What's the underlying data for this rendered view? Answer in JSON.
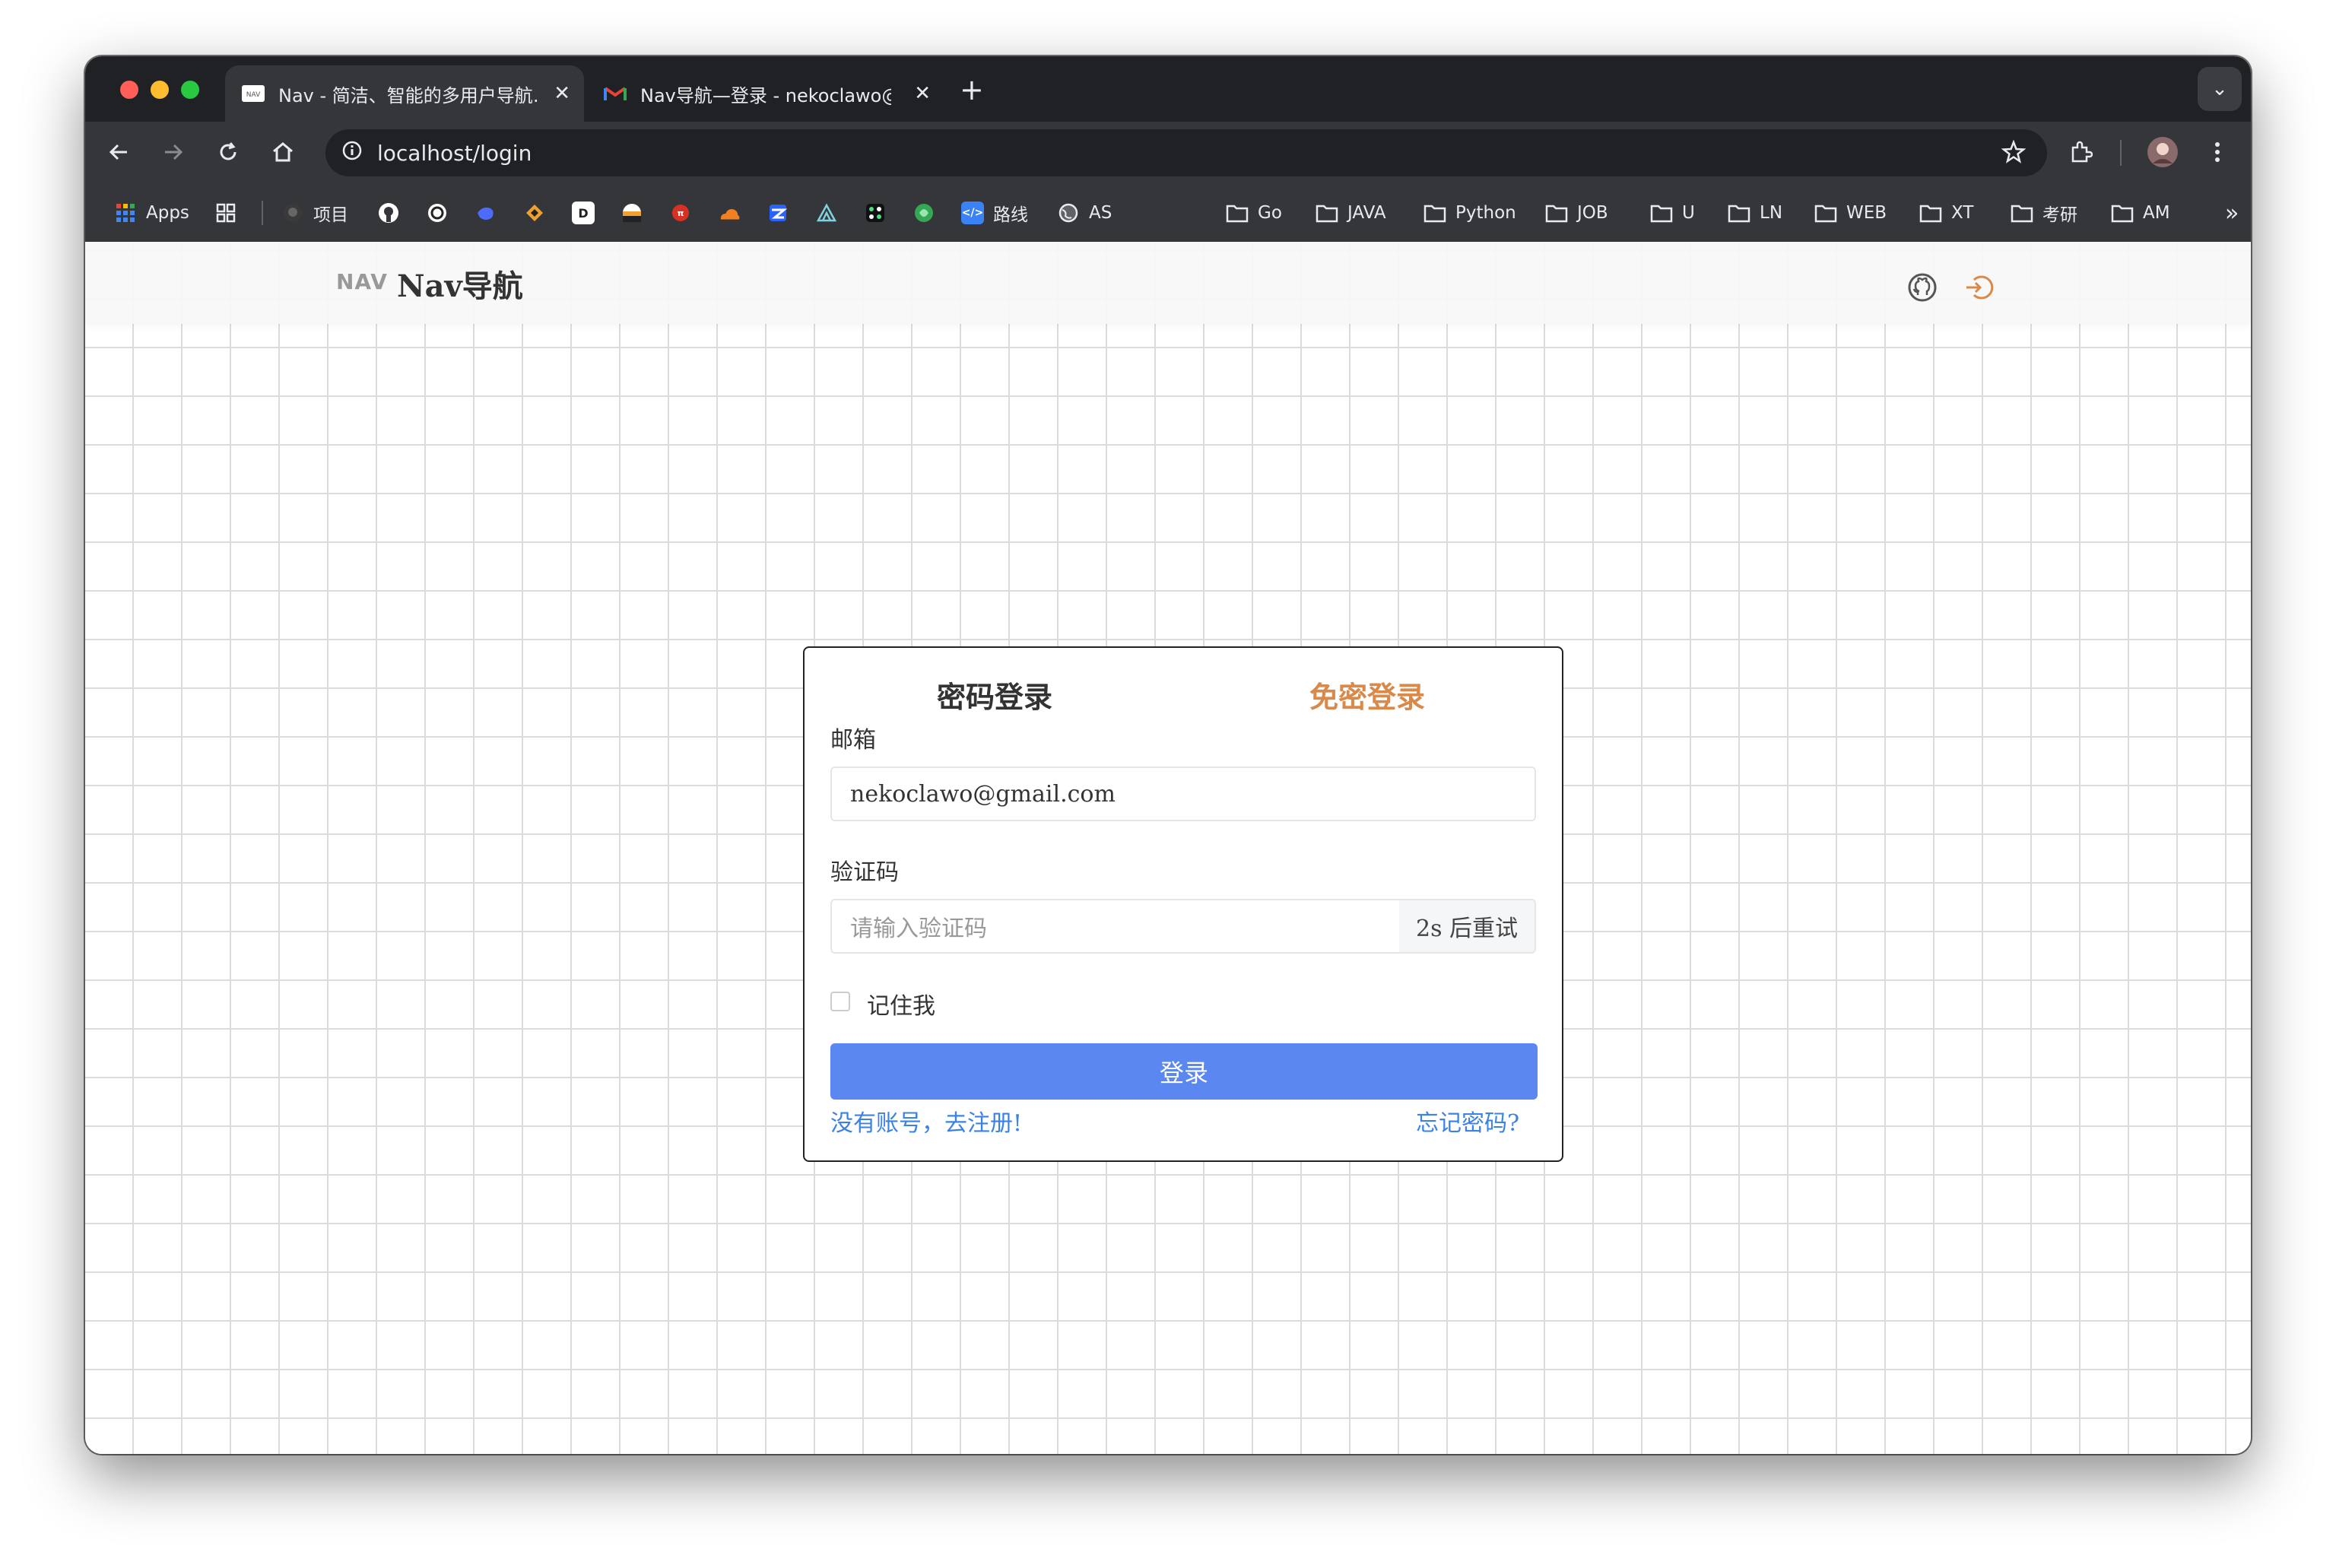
{
  "browser": {
    "tabs": [
      {
        "title": "Nav - 简洁、智能的多用户导航…",
        "favicon": "nav-favicon",
        "active": true
      },
      {
        "title": "Nav导航—登录 - nekoclawo@…",
        "favicon": "gmail-favicon",
        "active": false
      }
    ],
    "url": "localhost/login",
    "bookmarks": [
      {
        "label": "Apps",
        "icon": "apps-grid-icon"
      },
      {
        "label": "",
        "icon": "tab-groups-icon"
      },
      {
        "label": "项目",
        "icon": "github-icon"
      },
      {
        "label": "",
        "icon": "github-icon"
      },
      {
        "label": "",
        "icon": "openai-icon"
      },
      {
        "label": "",
        "icon": "deepseek-icon"
      },
      {
        "label": "",
        "icon": "bookmark-icon"
      },
      {
        "label": "",
        "icon": "bookmark-icon"
      },
      {
        "label": "",
        "icon": "bookmark-icon"
      },
      {
        "label": "",
        "icon": "bookmark-icon"
      },
      {
        "label": "",
        "icon": "cloudflare-icon"
      },
      {
        "label": "",
        "icon": "bookmark-icon"
      },
      {
        "label": "",
        "icon": "bookmark-icon"
      },
      {
        "label": "",
        "icon": "bookmark-icon"
      },
      {
        "label": "",
        "icon": "bookmark-icon"
      },
      {
        "label": "路线",
        "icon": "code-icon"
      },
      {
        "label": "AS",
        "icon": "globe-icon"
      },
      {
        "label": "Go",
        "icon": "folder-icon"
      },
      {
        "label": "JAVA",
        "icon": "folder-icon"
      },
      {
        "label": "Python",
        "icon": "folder-icon"
      },
      {
        "label": "JOB",
        "icon": "folder-icon"
      },
      {
        "label": "U",
        "icon": "folder-icon"
      },
      {
        "label": "LN",
        "icon": "folder-icon"
      },
      {
        "label": "WEB",
        "icon": "folder-icon"
      },
      {
        "label": "XT",
        "icon": "folder-icon"
      },
      {
        "label": "考研",
        "icon": "folder-icon"
      },
      {
        "label": "AM",
        "icon": "folder-icon"
      }
    ]
  },
  "site": {
    "logo_text": "NAV",
    "brand": "Nav导航"
  },
  "login": {
    "tab_password": "密码登录",
    "tab_passwordless": "免密登录",
    "email_label": "邮箱",
    "email_value": "nekoclawo@gmail.com",
    "code_label": "验证码",
    "code_placeholder": "请输入验证码",
    "retry_label": "2s 后重试",
    "remember_label": "记住我",
    "submit_label": "登录",
    "register_link": "没有账号，去注册!",
    "forgot_link": "忘记密码?"
  },
  "colors": {
    "accent_orange": "#d98a4a",
    "primary_blue": "#5b87f0",
    "link_blue": "#3b82e6"
  }
}
